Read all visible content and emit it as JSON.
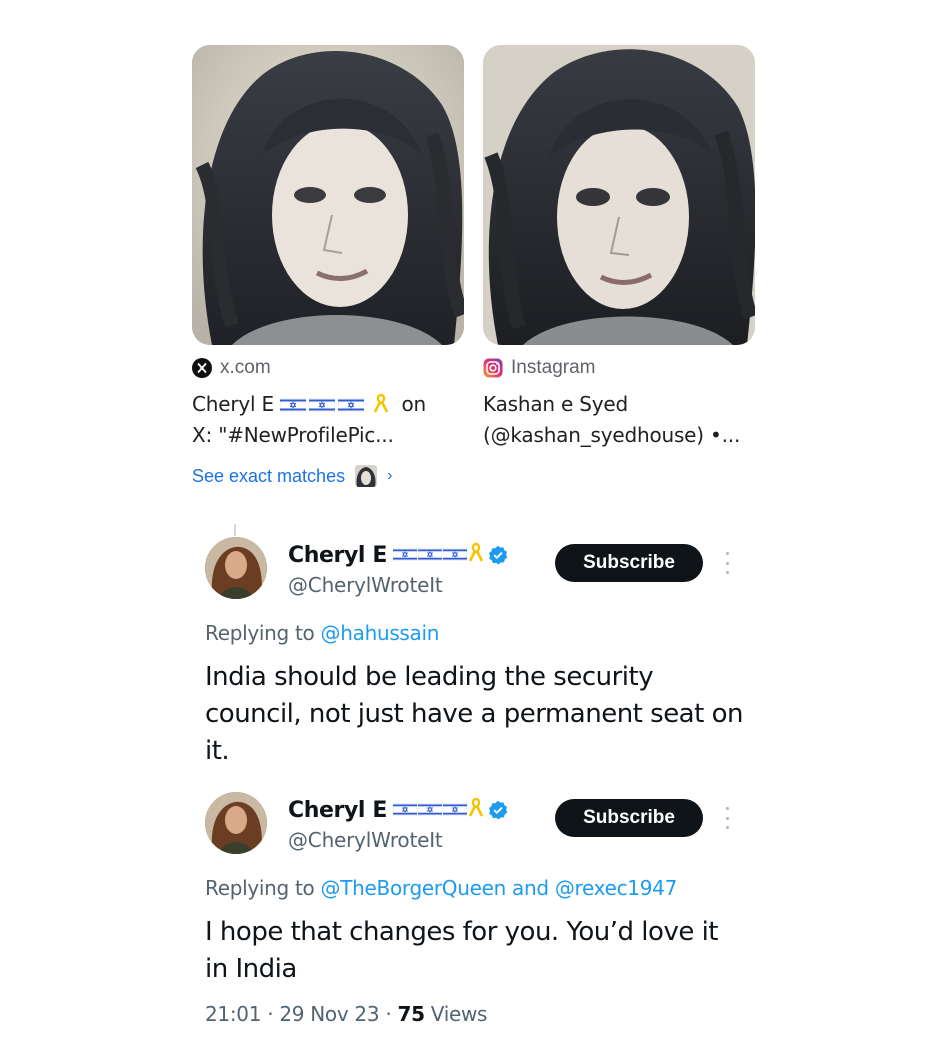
{
  "results": [
    {
      "source": "x.com",
      "source_icon": "x-logo-icon",
      "title_name": "Cheryl E",
      "title_suffix": "on",
      "title_line2": "X: \"#NewProfilePic..."
    },
    {
      "source": "Instagram",
      "source_icon": "instagram-logo-icon",
      "title_line1": "Kashan e Syed",
      "title_line2": "(@kashan_syedhouse) •..."
    }
  ],
  "see_exact_matches": "See exact matches",
  "tweets": [
    {
      "display_name": "Cheryl E",
      "handle": "@CherylWroteIt",
      "subscribe_label": "Subscribe",
      "replying_prefix": "Replying to",
      "replying_to": "@hahussain",
      "text": "India should be leading the security council, not just have a permanent seat on it."
    },
    {
      "display_name": "Cheryl E",
      "handle": "@CherylWroteIt",
      "subscribe_label": "Subscribe",
      "replying_prefix": "Replying to",
      "replying_to": "@TheBorgerQueen",
      "replying_and": "and",
      "replying_to_2": "@rexec1947",
      "text": "I hope that changes for you. You’d love it in India",
      "time": "21:01",
      "date": "29 Nov 23",
      "views_count": "75",
      "views_label": "Views"
    }
  ],
  "colors": {
    "link_blue": "#1a73e8",
    "mention_blue": "#1d9bf0",
    "verified_blue": "#1d9bf0",
    "subscribe_bg": "#0f1419",
    "muted_text": "#536471",
    "ribbon_yellow": "#f5c400",
    "flag_blue": "#2f5bd3"
  }
}
